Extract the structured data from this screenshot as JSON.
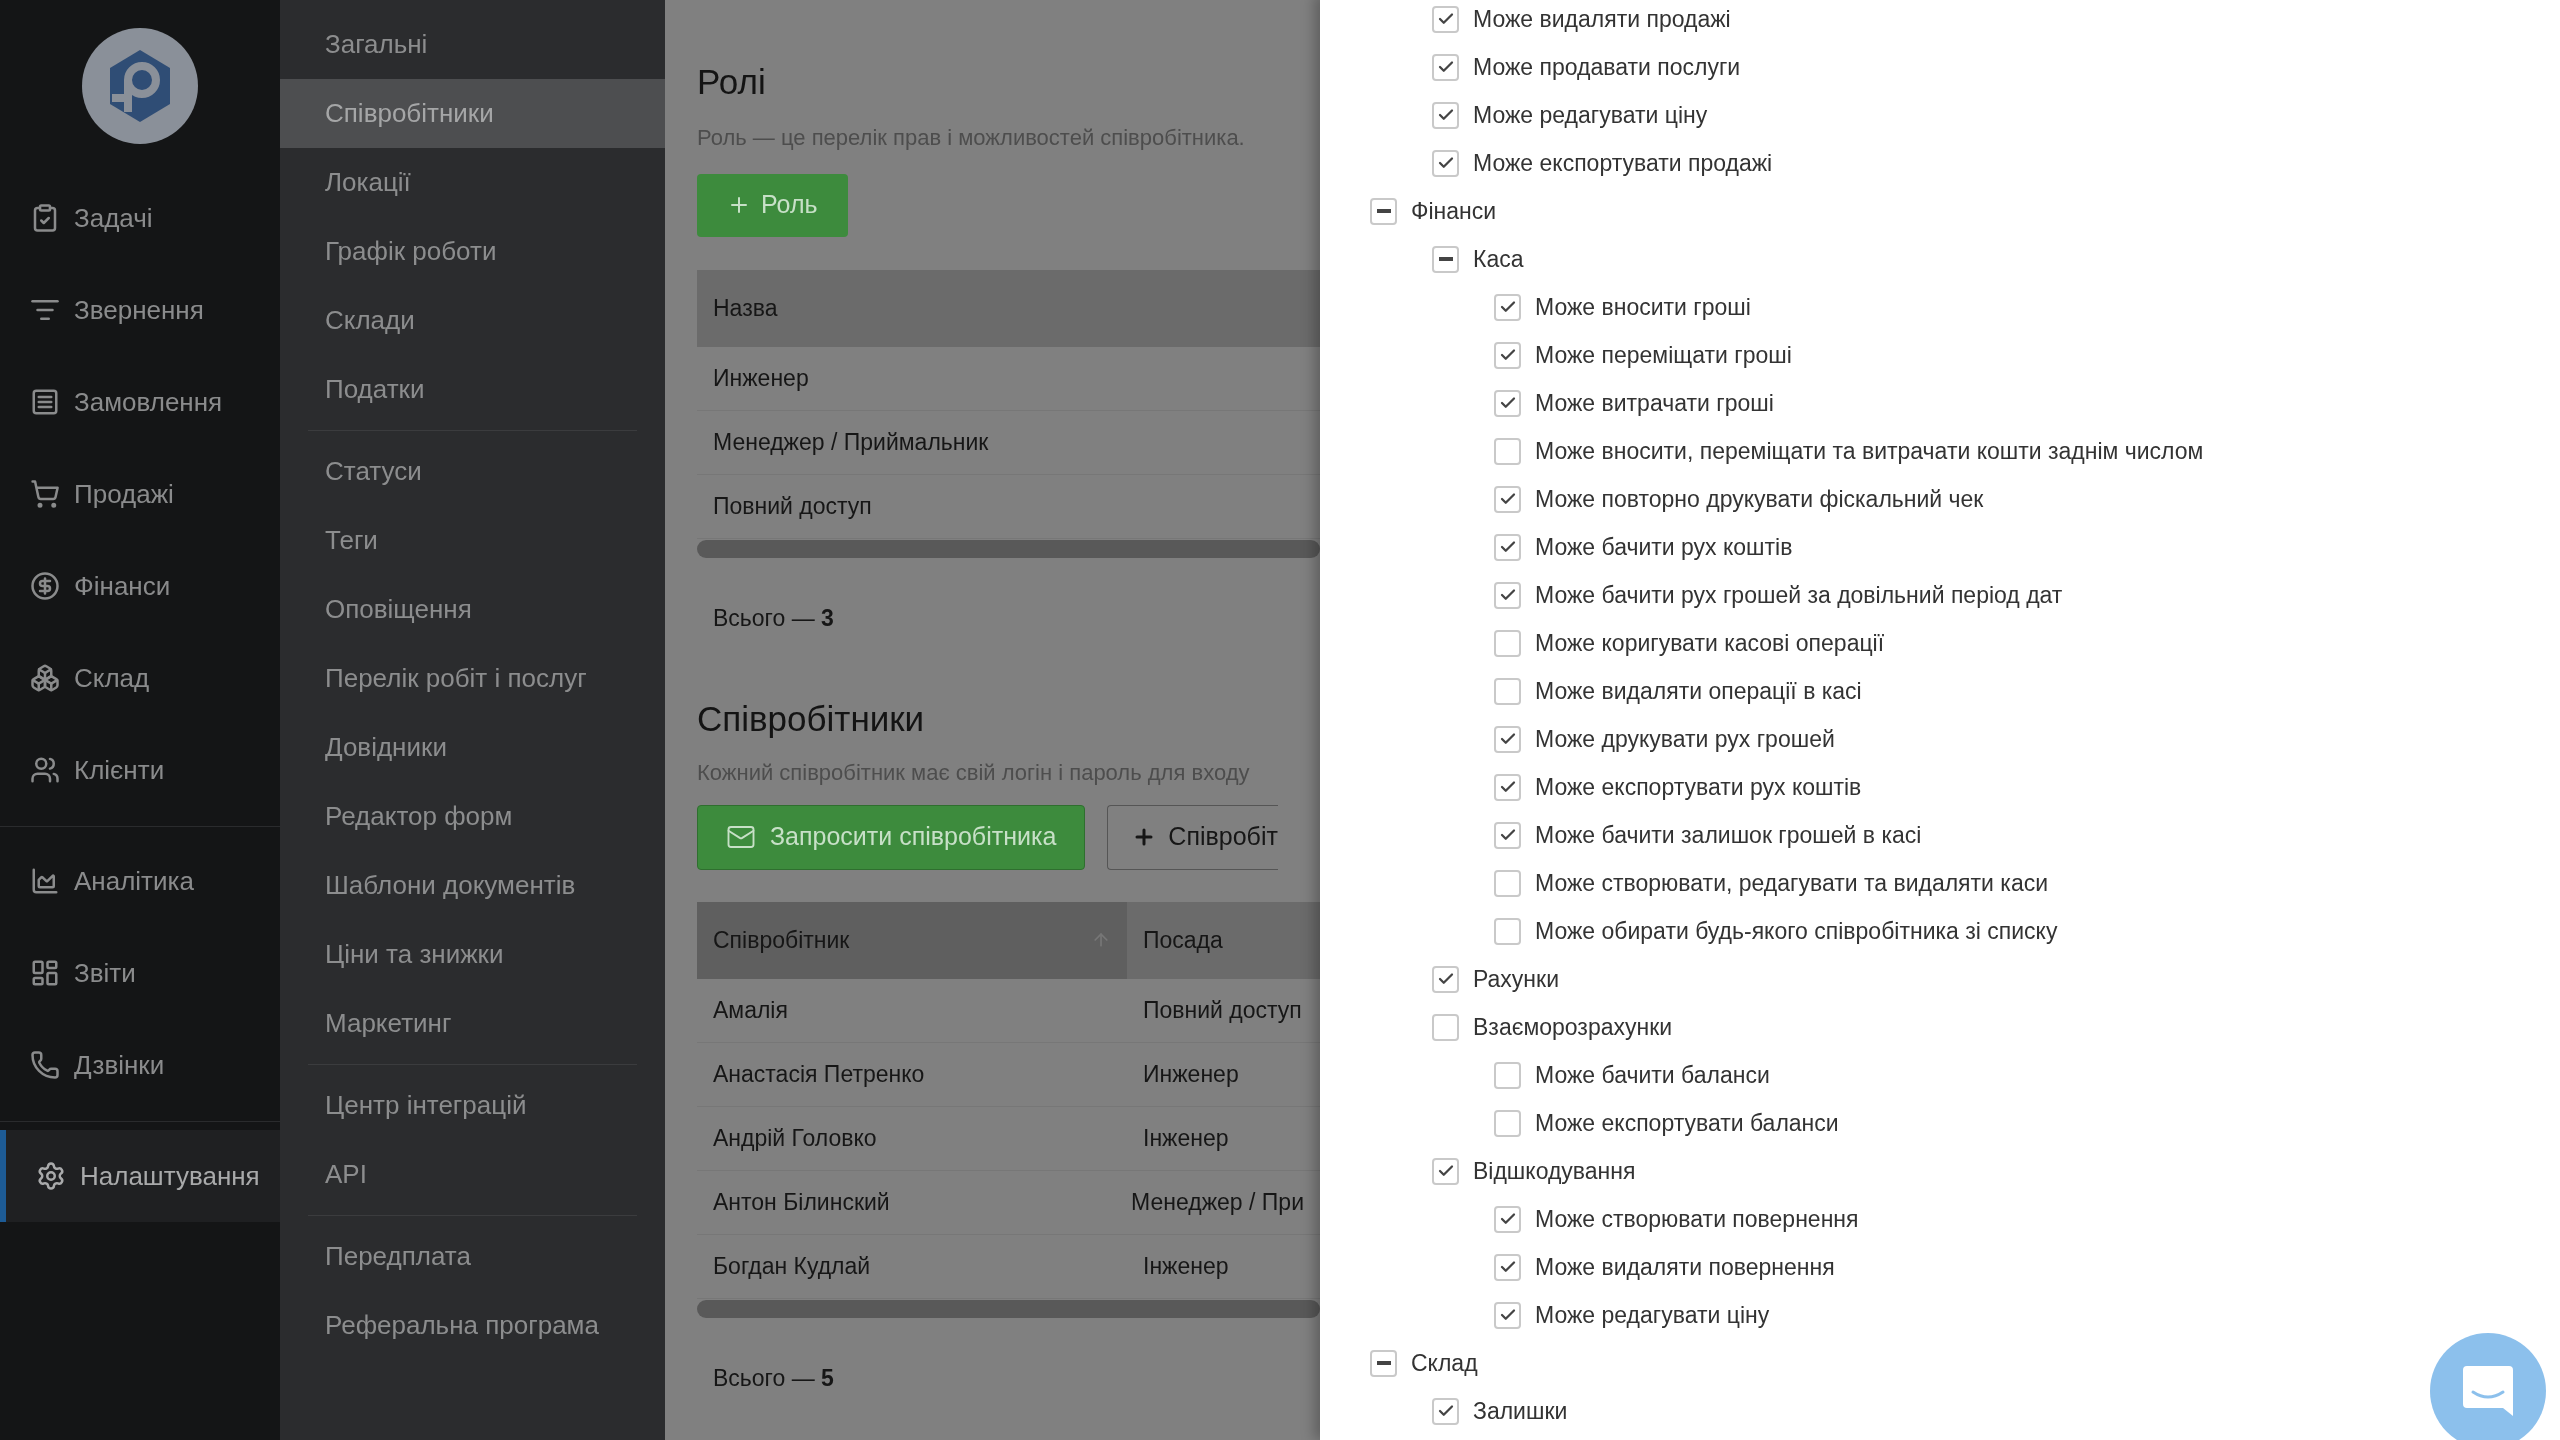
{
  "nav": {
    "groups": [
      [
        {
          "label": "Задачі",
          "selected": false
        },
        {
          "label": "Звернення",
          "selected": false
        },
        {
          "label": "Замовлення",
          "selected": false
        },
        {
          "label": "Продажі",
          "selected": false
        },
        {
          "label": "Фінанси",
          "selected": false
        },
        {
          "label": "Склад",
          "selected": false
        },
        {
          "label": "Клієнти",
          "selected": false
        }
      ],
      [
        {
          "label": "Аналітика",
          "selected": false
        },
        {
          "label": "Звіти",
          "selected": false
        },
        {
          "label": "Дзвінки",
          "selected": false
        }
      ],
      [
        {
          "label": "Налаштування",
          "selected": true
        }
      ]
    ]
  },
  "settings_menu": {
    "groups": [
      [
        {
          "label": "Загальні",
          "selected": false
        },
        {
          "label": "Співробітники",
          "selected": true
        },
        {
          "label": "Локації",
          "selected": false
        },
        {
          "label": "Графік роботи",
          "selected": false
        },
        {
          "label": "Склади",
          "selected": false
        },
        {
          "label": "Податки",
          "selected": false
        }
      ],
      [
        {
          "label": "Статуси",
          "selected": false
        },
        {
          "label": "Теги",
          "selected": false
        },
        {
          "label": "Оповіщення",
          "selected": false
        },
        {
          "label": "Перелік робіт і послуг",
          "selected": false
        },
        {
          "label": "Довідники",
          "selected": false
        },
        {
          "label": "Редактор форм",
          "selected": false
        },
        {
          "label": "Шаблони документів",
          "selected": false
        },
        {
          "label": "Ціни та знижки",
          "selected": false
        },
        {
          "label": "Маркетинг",
          "selected": false
        }
      ],
      [
        {
          "label": "Центр інтеграцій",
          "selected": false
        },
        {
          "label": "API",
          "selected": false
        }
      ],
      [
        {
          "label": "Передплата",
          "selected": false
        },
        {
          "label": "Реферальна програма",
          "selected": false
        }
      ]
    ]
  },
  "roles": {
    "title": "Ролі",
    "subtitle": "Роль — це перелік прав і можливостей співробітника.",
    "add_button": "Роль",
    "columns": [
      "Назва"
    ],
    "rows": [
      [
        "Инженер"
      ],
      [
        "Менеджер / Приймальник"
      ],
      [
        "Повний доступ"
      ]
    ],
    "total": "Всього — **3**"
  },
  "employees": {
    "title": "Співробітники",
    "subtitle": "Кожний співробітник має свій логін і пароль для входу",
    "invite_button": "Запросити співробітника",
    "add_button": "Співробіт",
    "columns": [
      "Співробітник",
      "Посада"
    ],
    "rows": [
      [
        "Амалія",
        "Повний доступ"
      ],
      [
        "Анастасія Петренко",
        "Инженер"
      ],
      [
        "Андрій Головко",
        "Інженер"
      ],
      [
        "Антон Білинский",
        "Менеджер / При"
      ],
      [
        "Богдан Кудлай",
        "Інженер"
      ]
    ],
    "total": "Всього — **5**"
  },
  "permissions": [
    {
      "children": [
        {
          "label": "Може видаляти продажі",
          "checked": true,
          "partial": false
        },
        {
          "label": "Може продавати послуги",
          "checked": true,
          "partial": false
        },
        {
          "label": "Може редагувати ціну",
          "checked": true,
          "partial": false
        },
        {
          "label": "Може експортувати продажі",
          "checked": true,
          "partial": false
        }
      ]
    },
    {
      "label": "Фінанси",
      "checked": false,
      "partial": true,
      "children": [
        {
          "label": "Каса",
          "checked": false,
          "partial": true,
          "children": [
            {
              "label": "Може вносити гроші",
              "checked": true,
              "partial": false
            },
            {
              "label": "Може переміщати гроші",
              "checked": true,
              "partial": false
            },
            {
              "label": "Може витрачати гроші",
              "checked": true,
              "partial": false
            },
            {
              "label": "Може вносити, переміщати та витрачати кошти заднім числом",
              "checked": false,
              "partial": false
            },
            {
              "label": "Може повторно друкувати фіскальний чек",
              "checked": true,
              "partial": false
            },
            {
              "label": "Може бачити рух коштів",
              "checked": true,
              "partial": false
            },
            {
              "label": "Може бачити рух грошей за довільний період дат",
              "checked": true,
              "partial": false
            },
            {
              "label": "Може коригувати касові операції",
              "checked": false,
              "partial": false
            },
            {
              "label": "Може видаляти операції в касі",
              "checked": false,
              "partial": false
            },
            {
              "label": "Може друкувати рух грошей",
              "checked": true,
              "partial": false
            },
            {
              "label": "Може експортувати рух коштів",
              "checked": true,
              "partial": false
            },
            {
              "label": "Може бачити залишок грошей в касі",
              "checked": true,
              "partial": false
            },
            {
              "label": "Може створювати, редагувати та видаляти каси",
              "checked": false,
              "partial": false
            },
            {
              "label": "Може обирати будь-якого співробітника зі списку",
              "checked": false,
              "partial": false
            }
          ]
        },
        {
          "label": "Рахунки",
          "checked": true,
          "partial": false
        },
        {
          "label": "Взаєморозрахунки",
          "checked": false,
          "partial": false,
          "children": [
            {
              "label": "Може бачити баланси",
              "checked": false,
              "partial": false
            },
            {
              "label": "Може експортувати баланси",
              "checked": false,
              "partial": false
            }
          ]
        },
        {
          "label": "Відшкодування",
          "checked": true,
          "partial": false,
          "children": [
            {
              "label": "Може створювати повернення",
              "checked": true,
              "partial": false
            },
            {
              "label": "Може видаляти повернення",
              "checked": true,
              "partial": false
            },
            {
              "label": "Може редагувати ціну",
              "checked": true,
              "partial": false
            }
          ]
        }
      ]
    },
    {
      "label": "Склад",
      "checked": false,
      "partial": true,
      "children": [
        {
          "label": "Залишки",
          "checked": true,
          "partial": false
        }
      ]
    }
  ]
}
